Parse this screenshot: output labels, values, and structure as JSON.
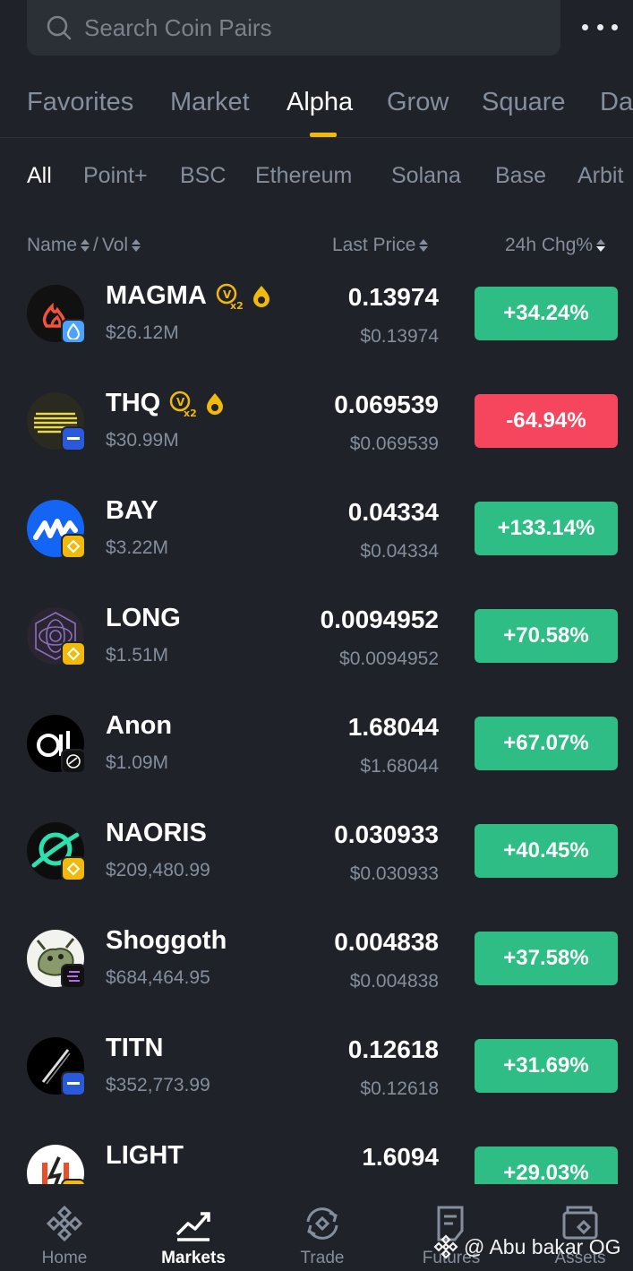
{
  "search": {
    "placeholder": "Search Coin Pairs"
  },
  "primary_tabs": [
    "Favorites",
    "Market",
    "Alpha",
    "Grow",
    "Square",
    "Da"
  ],
  "secondary_tabs": [
    "All",
    "Point+",
    "BSC",
    "Ethereum",
    "Solana",
    "Base",
    "Arbit"
  ],
  "columns": {
    "name": "Name",
    "sep": "/",
    "vol": "Vol",
    "price": "Last Price",
    "change": "24h Chg%"
  },
  "colors": {
    "up": "#2ebd85",
    "down": "#f6465d",
    "accent": "#f0b90b"
  },
  "coins": [
    {
      "name": "MAGMA",
      "vol": "$26.12M",
      "price": "0.13974",
      "price_usd": "$0.13974",
      "change": "+34.24%",
      "direction": "up"
    },
    {
      "name": "THQ",
      "vol": "$30.99M",
      "price": "0.069539",
      "price_usd": "$0.069539",
      "change": "-64.94%",
      "direction": "down"
    },
    {
      "name": "BAY",
      "vol": "$3.22M",
      "price": "0.04334",
      "price_usd": "$0.04334",
      "change": "+133.14%",
      "direction": "up"
    },
    {
      "name": "LONG",
      "vol": "$1.51M",
      "price": "0.0094952",
      "price_usd": "$0.0094952",
      "change": "+70.58%",
      "direction": "up"
    },
    {
      "name": "Anon",
      "vol": "$1.09M",
      "price": "1.68044",
      "price_usd": "$1.68044",
      "change": "+67.07%",
      "direction": "up"
    },
    {
      "name": "NAORIS",
      "vol": "$209,480.99",
      "price": "0.030933",
      "price_usd": "$0.030933",
      "change": "+40.45%",
      "direction": "up"
    },
    {
      "name": "Shoggoth",
      "vol": "$684,464.95",
      "price": "0.004838",
      "price_usd": "$0.004838",
      "change": "+37.58%",
      "direction": "up"
    },
    {
      "name": "TITN",
      "vol": "$352,773.99",
      "price": "0.12618",
      "price_usd": "$0.12618",
      "change": "+31.69%",
      "direction": "up"
    },
    {
      "name": "LIGHT",
      "vol": "",
      "price": "1.6094",
      "price_usd": "",
      "change": "+29.03%",
      "direction": "up"
    }
  ],
  "bottom_nav": [
    "Home",
    "Markets",
    "Trade",
    "Futures",
    "Assets"
  ],
  "watermark": "@ Abu bakar OG"
}
